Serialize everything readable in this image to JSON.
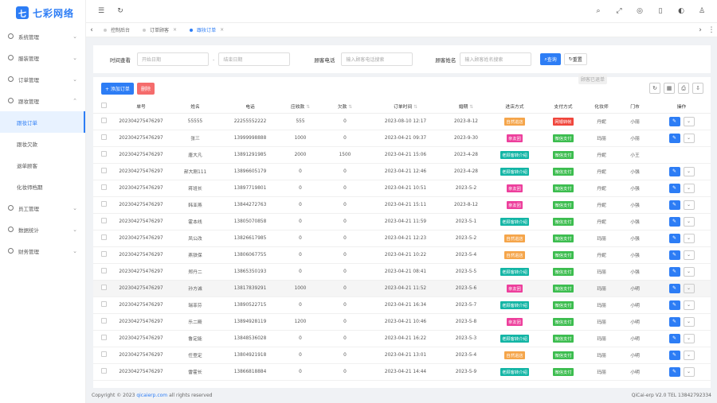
{
  "app": {
    "logo_glyph": "七",
    "logo_text": "七彩网络"
  },
  "sidebar": {
    "items": [
      {
        "label": "系统管理"
      },
      {
        "label": "服装管理"
      },
      {
        "label": "订单管理"
      },
      {
        "label": "跟妆管理"
      }
    ],
    "sub_items": [
      {
        "label": "跟妆订单"
      },
      {
        "label": "跟妆欠款"
      },
      {
        "label": "退单顾客"
      },
      {
        "label": "化妆师档期"
      }
    ],
    "bottom_items": [
      {
        "label": "员工管理"
      },
      {
        "label": "数据统计"
      },
      {
        "label": "财务管理"
      }
    ]
  },
  "tabs": [
    {
      "label": "控制后台"
    },
    {
      "label": "订单顾客"
    },
    {
      "label": "跟妆订单"
    }
  ],
  "search": {
    "time_label": "时间查看",
    "start_placeholder": "开始日期",
    "sep": "-",
    "end_placeholder": "结束日期",
    "phone_label": "顾客电话",
    "phone_placeholder": "输入顾客电话搜索",
    "name_label": "顾客姓名",
    "name_placeholder": "输入顾客姓名搜索",
    "query_label": "查询",
    "reset_label": "重置"
  },
  "toolbar": {
    "add_label": "+ 添加订单",
    "delete_label": "删除"
  },
  "tooltip": "顾客已退单",
  "columns": [
    "单号",
    "姓名",
    "电话",
    "应收款",
    "欠款",
    "订单时间",
    "婚期",
    "进店方式",
    "支付方式",
    "化妆师",
    "门市",
    "操作"
  ],
  "colors": {
    "自然进店": "#f5a54a",
    "亲友团": "#ed3f9c",
    "老顾客转介绍": "#13b5a5",
    "网银转帐": "#f0463c",
    "微信支付": "#3cbd4f"
  },
  "rows": [
    {
      "id": "202304275476297",
      "name": "55555",
      "phone": "22255552222",
      "recv": "555",
      "owe": "0",
      "time": "2023-08-10 12:17",
      "wed": "2023-8-12",
      "way": "自然进店",
      "pay": "网银转帐",
      "artist": "丹妮",
      "store": "小丽"
    },
    {
      "id": "202304275476297",
      "name": "张三",
      "phone": "13999998888",
      "recv": "1000",
      "owe": "0",
      "time": "2023-04-21 09:37",
      "wed": "2023-9-30",
      "way": "亲友团",
      "pay": "微信支付",
      "artist": "玛丽",
      "store": "小丽"
    },
    {
      "id": "202304275476297",
      "name": "唐大凡",
      "phone": "13891291985",
      "recv": "2000",
      "owe": "1500",
      "time": "2023-04-21 15:06",
      "wed": "2023-4-28",
      "way": "老顾客转介绍",
      "pay": "微信支付",
      "artist": "丹妮",
      "store": "小王"
    },
    {
      "id": "202304275476297",
      "name": "郝大刚111",
      "phone": "13896605179",
      "recv": "0",
      "owe": "0",
      "time": "2023-04-21 12:46",
      "wed": "2023-4-28",
      "way": "老顾客转介绍",
      "pay": "微信支付",
      "artist": "丹妮",
      "store": "小强"
    },
    {
      "id": "202304275476297",
      "name": "蒋班长",
      "phone": "13897719801",
      "recv": "0",
      "owe": "0",
      "time": "2023-04-21 10:51",
      "wed": "2023-5-2",
      "way": "亲友团",
      "pay": "微信支付",
      "artist": "丹妮",
      "store": "小强"
    },
    {
      "id": "202304275476297",
      "name": "韩亚燕",
      "phone": "13844272763",
      "recv": "0",
      "owe": "0",
      "time": "2023-04-21 15:11",
      "wed": "2023-8-12",
      "way": "亲友团",
      "pay": "微信支付",
      "artist": "丹妮",
      "store": "小强"
    },
    {
      "id": "202304275476297",
      "name": "霍本线",
      "phone": "13805070858",
      "recv": "0",
      "owe": "0",
      "time": "2023-04-21 11:59",
      "wed": "2023-5-1",
      "way": "老顾客转介绍",
      "pay": "微信支付",
      "artist": "丹妮",
      "store": "小强"
    },
    {
      "id": "202304275476297",
      "name": "凤公改",
      "phone": "13826617985",
      "recv": "0",
      "owe": "0",
      "time": "2023-04-21 12:23",
      "wed": "2023-5-2",
      "way": "自然进店",
      "pay": "微信支付",
      "artist": "玛丽",
      "store": "小强"
    },
    {
      "id": "202304275476297",
      "name": "燕铁保",
      "phone": "13806067755",
      "recv": "0",
      "owe": "0",
      "time": "2023-04-21 10:22",
      "wed": "2023-5-4",
      "way": "自然进店",
      "pay": "微信支付",
      "artist": "丹妮",
      "store": "小强"
    },
    {
      "id": "202304275476297",
      "name": "郑丹二",
      "phone": "13865350193",
      "recv": "0",
      "owe": "0",
      "time": "2023-04-21 08:41",
      "wed": "2023-5-5",
      "way": "老顾客转介绍",
      "pay": "微信支付",
      "artist": "玛丽",
      "store": "小强"
    },
    {
      "id": "202304275476297",
      "name": "孙方诚",
      "phone": "13817839291",
      "recv": "1000",
      "owe": "0",
      "time": "2023-04-21 11:52",
      "wed": "2023-5-6",
      "way": "亲友团",
      "pay": "微信支付",
      "artist": "玛丽",
      "store": "小明"
    },
    {
      "id": "202304275476297",
      "name": "瑞菲芬",
      "phone": "13890522715",
      "recv": "0",
      "owe": "0",
      "time": "2023-04-21 16:34",
      "wed": "2023-5-7",
      "way": "老顾客转介绍",
      "pay": "微信支付",
      "artist": "玛丽",
      "store": "小明"
    },
    {
      "id": "202304275476297",
      "name": "乐二殿",
      "phone": "13894928119",
      "recv": "1200",
      "owe": "0",
      "time": "2023-04-21 10:46",
      "wed": "2023-5-8",
      "way": "亲友团",
      "pay": "微信支付",
      "artist": "玛丽",
      "store": "小明"
    },
    {
      "id": "202304275476297",
      "name": "鲁定能",
      "phone": "13848536028",
      "recv": "0",
      "owe": "0",
      "time": "2023-04-21 16:22",
      "wed": "2023-5-3",
      "way": "老顾客转介绍",
      "pay": "微信支付",
      "artist": "玛丽",
      "store": "小明"
    },
    {
      "id": "202304275476297",
      "name": "任登定",
      "phone": "13804921918",
      "recv": "0",
      "owe": "0",
      "time": "2023-04-21 13:01",
      "wed": "2023-5-4",
      "way": "自然进店",
      "pay": "微信支付",
      "artist": "玛丽",
      "store": "小明"
    },
    {
      "id": "202304275476297",
      "name": "雷霍长",
      "phone": "13866818884",
      "recv": "0",
      "owe": "0",
      "time": "2023-04-21 14:44",
      "wed": "2023-5-9",
      "way": "老顾客转介绍",
      "pay": "微信支付",
      "artist": "玛丽",
      "store": "小明"
    }
  ],
  "footer": {
    "copy": "Copyright © 2023",
    "link": "qicaierp.com",
    "rights": "all rights reserved",
    "right": "QiCai-erp V2.0 TEL 13842792334"
  }
}
